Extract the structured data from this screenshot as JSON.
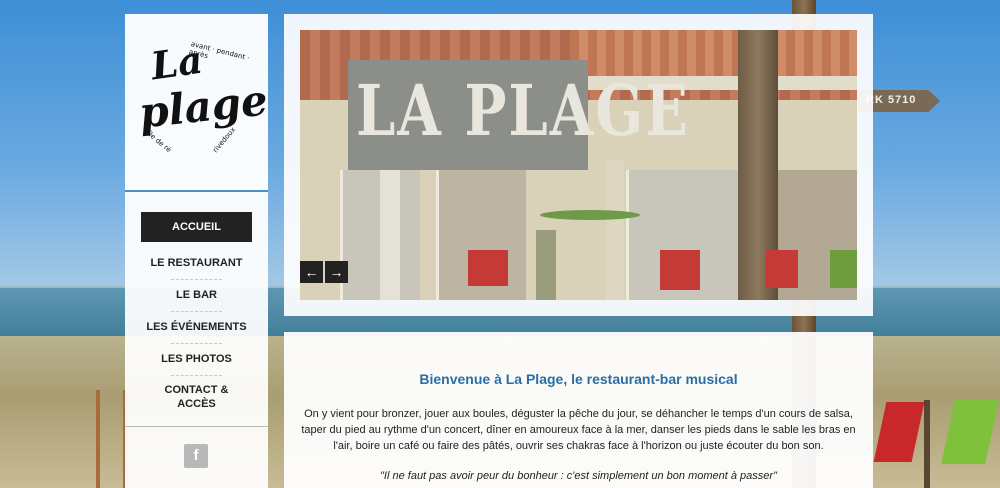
{
  "logo": {
    "line1": "La",
    "line2": "plage",
    "tagline": "avant · pendant · après",
    "left_caption": "île de ré",
    "right_caption": "rivedoux"
  },
  "nav": {
    "items": [
      {
        "label": "ACCUEIL",
        "active": true
      },
      {
        "label": "LE RESTAURANT",
        "active": false
      },
      {
        "label": "LE BAR",
        "active": false
      },
      {
        "label": "LES ÉVÉNEMENTS",
        "active": false
      },
      {
        "label": "LES PHOTOS",
        "active": false
      },
      {
        "label": "CONTACT & ACCÈS",
        "active": false
      }
    ],
    "facebook_icon": "facebook-icon"
  },
  "background": {
    "sign_text": "RK 5710"
  },
  "slider": {
    "sign_text": "LA PLAGE",
    "prev_icon": "arrow-left-icon",
    "next_icon": "arrow-right-icon",
    "prev_glyph": "←",
    "next_glyph": "→"
  },
  "content": {
    "title": "Bienvenue à La Plage, le restaurant-bar musical",
    "paragraph": "On y vient pour bronzer, jouer aux boules, déguster la pêche du jour, se déhancher le temps d'un cours de salsa, taper du pied au rythme d'un concert, dîner en amoureux face à la mer, danser les pieds dans le sable les bras en l'air, boire un café ou faire des pâtés, ouvrir ses chakras face à l'horizon ou juste écouter du bon son.",
    "quote": "\"Il ne faut pas avoir peur du bonheur : c'est simplement un bon moment à passer\""
  },
  "colors": {
    "accent": "#2a6ea6",
    "nav_active_bg": "#222222",
    "separator": "#4a90c8"
  }
}
